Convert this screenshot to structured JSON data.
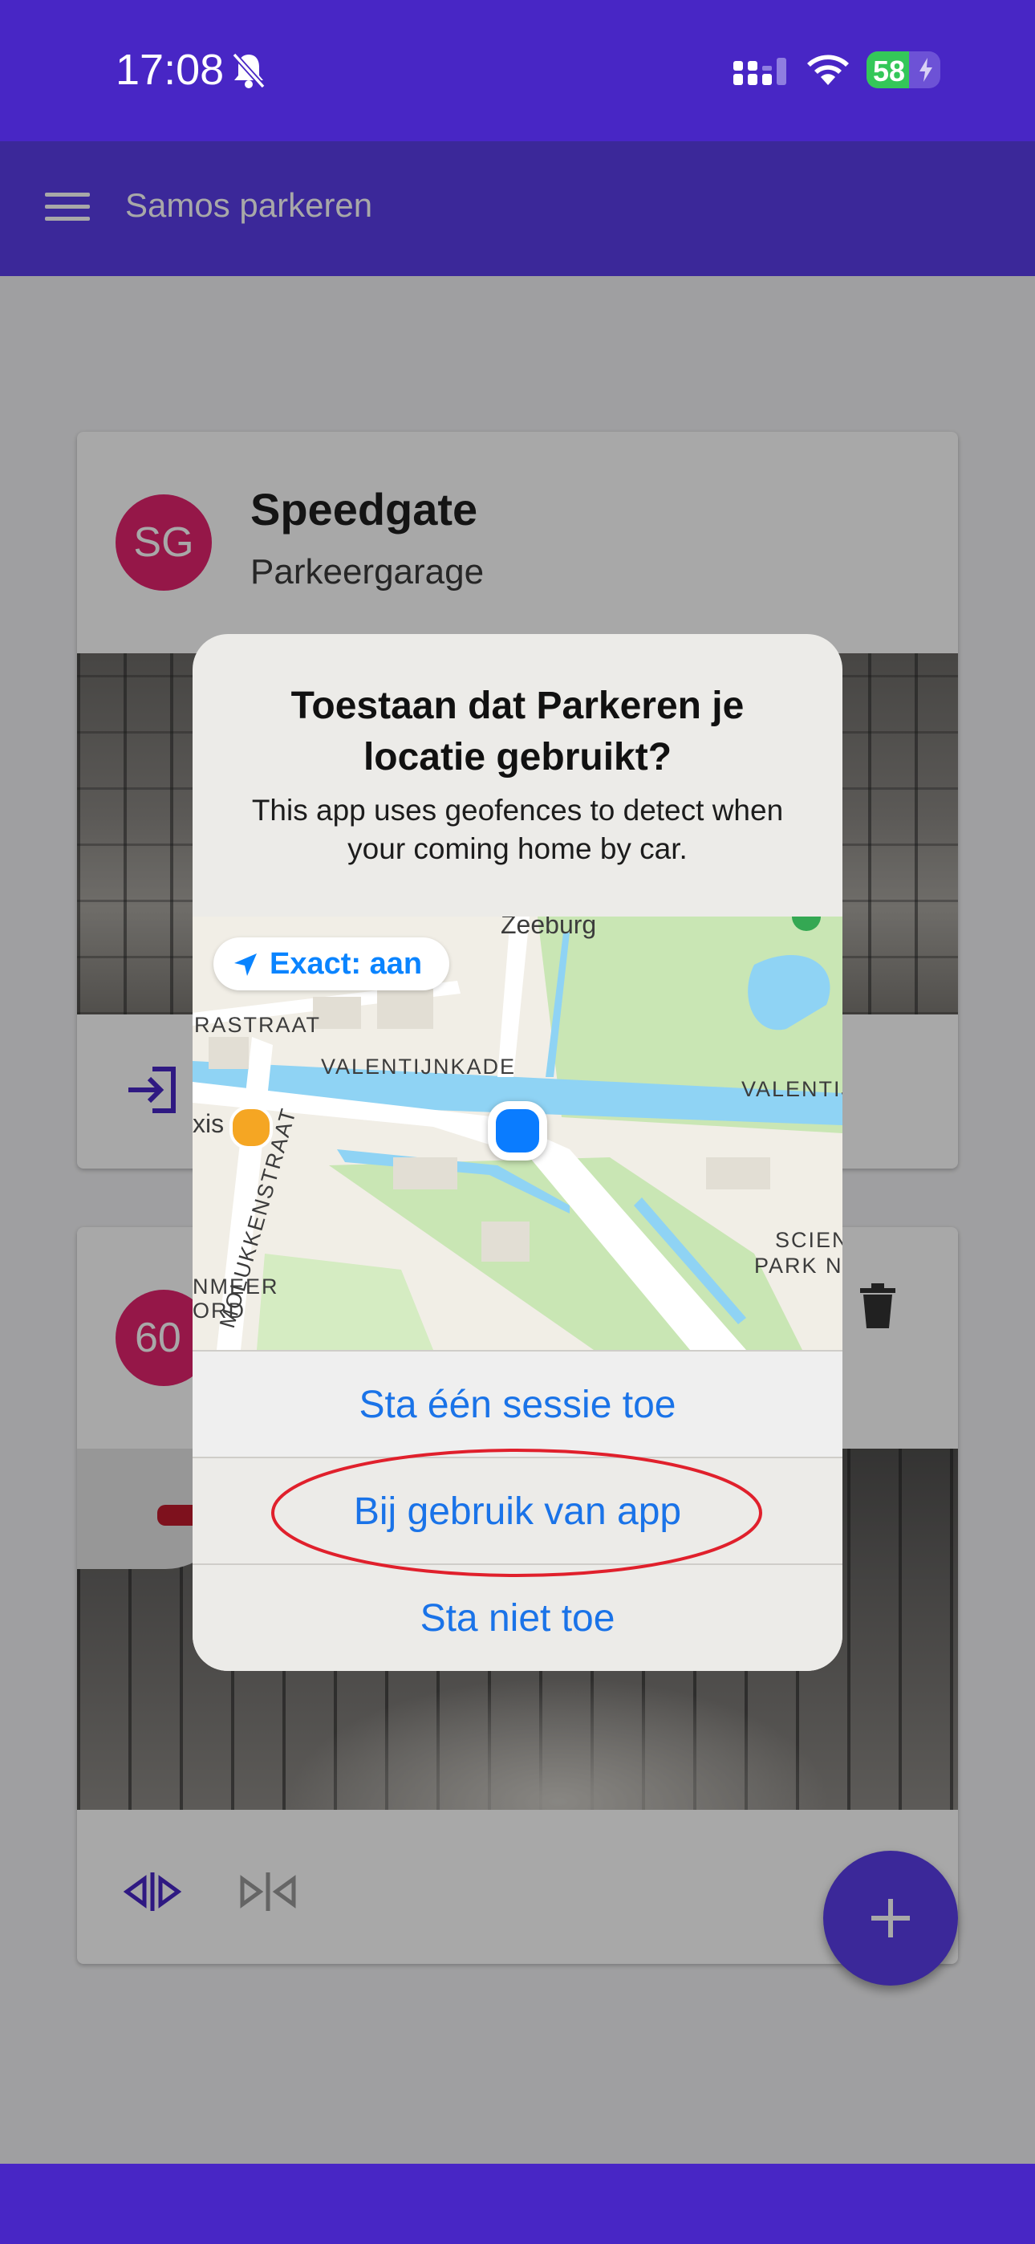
{
  "status_bar": {
    "time": "17:08",
    "battery": "58",
    "battery_level": 0.58,
    "icons": [
      "bell-muted-icon",
      "cellular-signal-icon",
      "wifi-icon",
      "battery-icon"
    ]
  },
  "app_bar": {
    "title": "Samos parkeren",
    "menu_icon": "hamburger-menu-icon"
  },
  "cards": [
    {
      "avatar": "SG",
      "title": "Speedgate",
      "subtitle": "Parkeergarage",
      "actions": [
        "login-icon"
      ]
    },
    {
      "avatar": "60",
      "title": "",
      "subtitle": "",
      "actions": [
        "split-icon",
        "merge-icon",
        "trash-icon"
      ]
    }
  ],
  "fab": {
    "icon": "plus-icon"
  },
  "dialog": {
    "title": "Toestaan dat Parkeren je locatie gebruikt?",
    "message": "This app uses geofences to detect when your coming home by car.",
    "precise_toggle": "Exact: aan",
    "map_labels": {
      "zeeburg": "Zeeburg",
      "rastraat": "RASTRAAT",
      "valentijnkade": "VALENTIJNKADE",
      "valentij": "VALENTIJ",
      "molukkenstraat": "MOLUKKENSTRAAT",
      "xis": "xis",
      "scien": "SCIEN",
      "park_no": "PARK NO",
      "nmeer": "NMEER",
      "ord": "ORD"
    },
    "buttons": {
      "allow_once": "Sta één sessie toe",
      "while_using": "Bij gebruik van app",
      "dont_allow": "Sta niet toe"
    }
  },
  "colors": {
    "primary": "#4826c5",
    "app_bar": "#5a3ee8",
    "avatar": "#e2236e",
    "ios_blue": "#1a73e8",
    "highlight": "#e0202c"
  }
}
